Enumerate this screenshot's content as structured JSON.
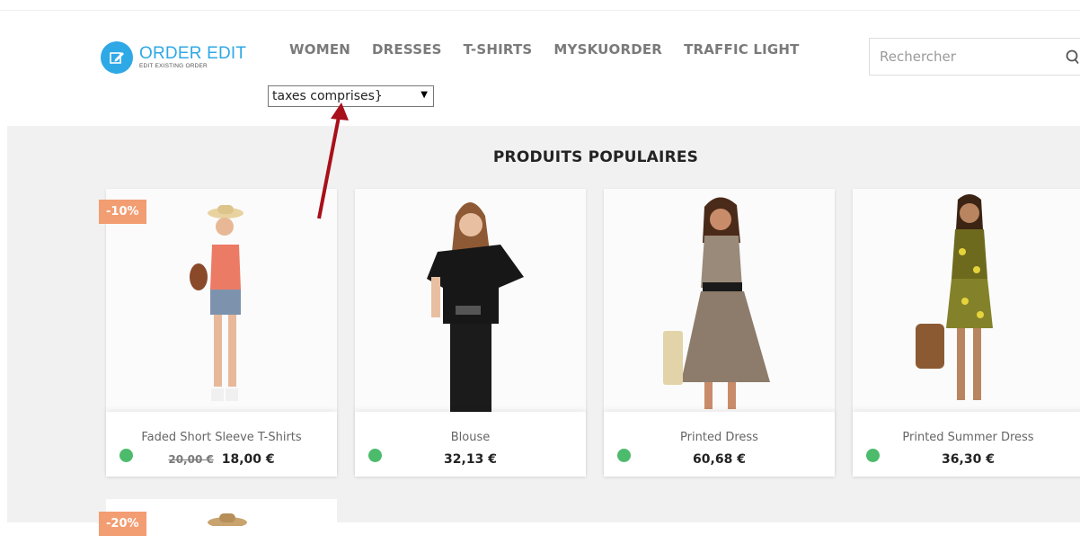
{
  "logo": {
    "title": "ORDER EDIT",
    "subtitle": "EDIT EXISTING ORDER"
  },
  "nav": [
    "WOMEN",
    "DRESSES",
    "T-SHIRTS",
    "MYSKUORDER",
    "TRAFFIC LIGHT"
  ],
  "tax_select": {
    "value": "taxes comprises}"
  },
  "search": {
    "placeholder": "Rechercher"
  },
  "section_title": "PRODUITS POPULAIRES",
  "products": [
    {
      "name": "Faded Short Sleeve T-Shirts",
      "old_price": "20,00 €",
      "price": "18,00 €",
      "badge": "-10%"
    },
    {
      "name": "Blouse",
      "price": "32,13 €"
    },
    {
      "name": "Printed Dress",
      "price": "60,68 €"
    },
    {
      "name": "Printed Summer Dress",
      "price": "36,30 €"
    }
  ],
  "next_row_badge": "-20%",
  "colors": {
    "accent": "#2fa8e6",
    "badge": "#f39d72",
    "stock_dot": "#4cbb6c",
    "annotation_arrow": "#a8101a"
  }
}
